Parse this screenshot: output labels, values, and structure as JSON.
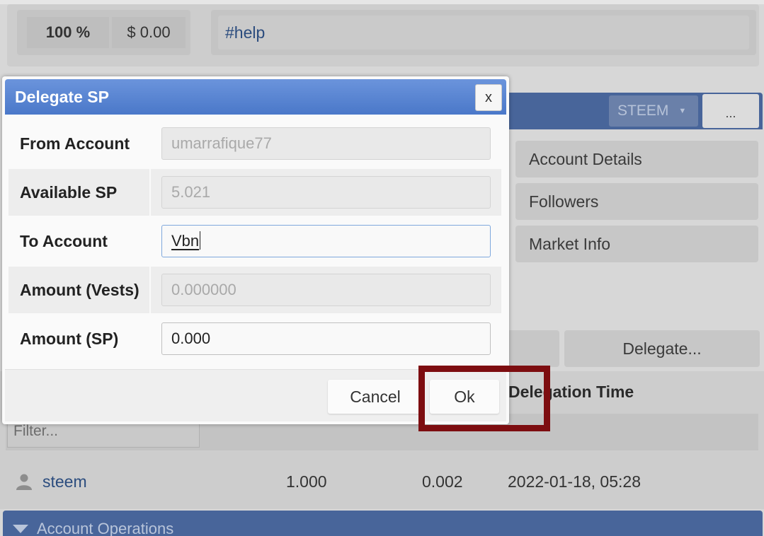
{
  "background": {
    "vote_percent": "100 %",
    "vote_value": "$ 0.00",
    "tag": "#help",
    "currency_select": "STEEM",
    "more_button": "...",
    "side_buttons": [
      "Account Details",
      "Followers",
      "Market Info"
    ],
    "delegate_button": "Delegate...",
    "table": {
      "header_time": "Delegation Time",
      "filter_placeholder": "Filter...",
      "rows": [
        {
          "user": "steem",
          "sp": "1.000",
          "vests": "0.002",
          "time": "2022-01-18, 05:28"
        }
      ]
    },
    "section_bar": "Account Operations"
  },
  "dialog": {
    "title": "Delegate SP",
    "close_label": "x",
    "fields": [
      {
        "label": "From Account",
        "value": "umarrafique77"
      },
      {
        "label": "Available SP",
        "value": "5.021"
      },
      {
        "label": "To Account",
        "value": "Vbn"
      },
      {
        "label": "Amount (Vests)",
        "value": "0.000000"
      },
      {
        "label": "Amount (SP)",
        "value": "0.000"
      }
    ],
    "cancel_label": "Cancel",
    "ok_label": "Ok"
  },
  "colors": {
    "header_blue": "#4a78c9",
    "highlight": "#7d0d10"
  }
}
